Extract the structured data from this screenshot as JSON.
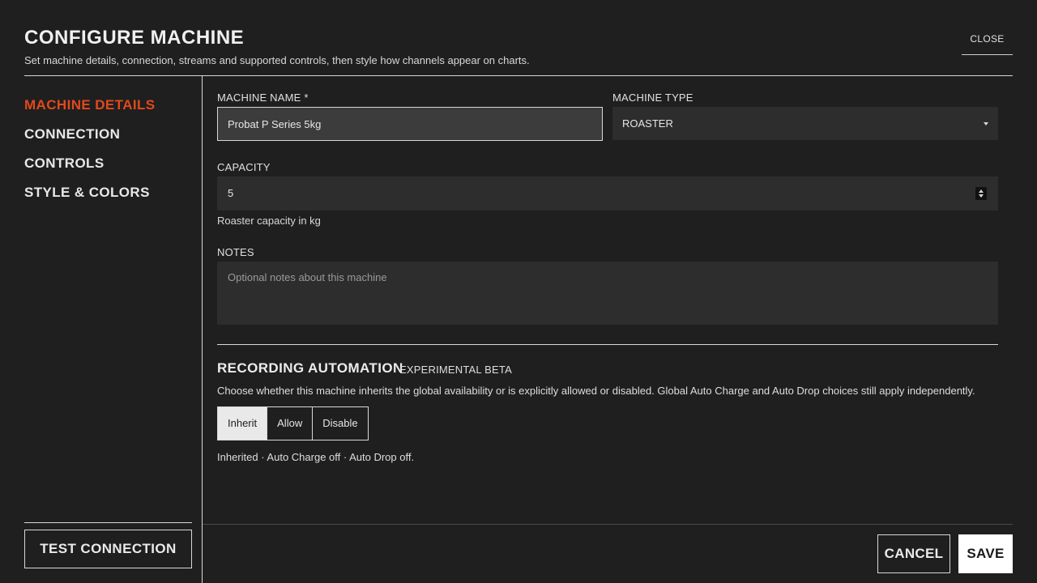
{
  "header": {
    "title": "CONFIGURE MACHINE",
    "subtitle": "Set machine details, connection, streams and supported controls, then style how channels appear on charts.",
    "close_label": "CLOSE"
  },
  "sidebar": {
    "items": [
      {
        "label": "MACHINE DETAILS",
        "active": true
      },
      {
        "label": "CONNECTION",
        "active": false
      },
      {
        "label": "CONTROLS",
        "active": false
      },
      {
        "label": "STYLE & COLORS",
        "active": false
      }
    ],
    "test_connection_label": "TEST CONNECTION"
  },
  "form": {
    "machine_name": {
      "label": "MACHINE NAME *",
      "value": "Probat P Series 5kg"
    },
    "machine_type": {
      "label": "MACHINE TYPE",
      "value": "ROASTER",
      "icon": "chevron-down-icon"
    },
    "capacity": {
      "label": "CAPACITY",
      "value": "5",
      "helper": "Roaster capacity in kg"
    },
    "notes": {
      "label": "NOTES",
      "placeholder": "Optional notes about this machine",
      "value": ""
    }
  },
  "automation": {
    "title": "RECORDING AUTOMATION",
    "badge": "EXPERIMENTAL BETA",
    "description": "Choose whether this machine inherits the global availability or is explicitly allowed or disabled. Global Auto Charge and Auto Drop choices still apply independently.",
    "options": [
      {
        "label": "Inherit",
        "selected": true
      },
      {
        "label": "Allow",
        "selected": false
      },
      {
        "label": "Disable",
        "selected": false
      }
    ],
    "status": "Inherited · Auto Charge off · Auto Drop off."
  },
  "footer": {
    "cancel_label": "CANCEL",
    "save_label": "SAVE"
  },
  "colors": {
    "background": "#1f1f1f",
    "accent": "#e2491b",
    "field": "#2e2d2d"
  }
}
